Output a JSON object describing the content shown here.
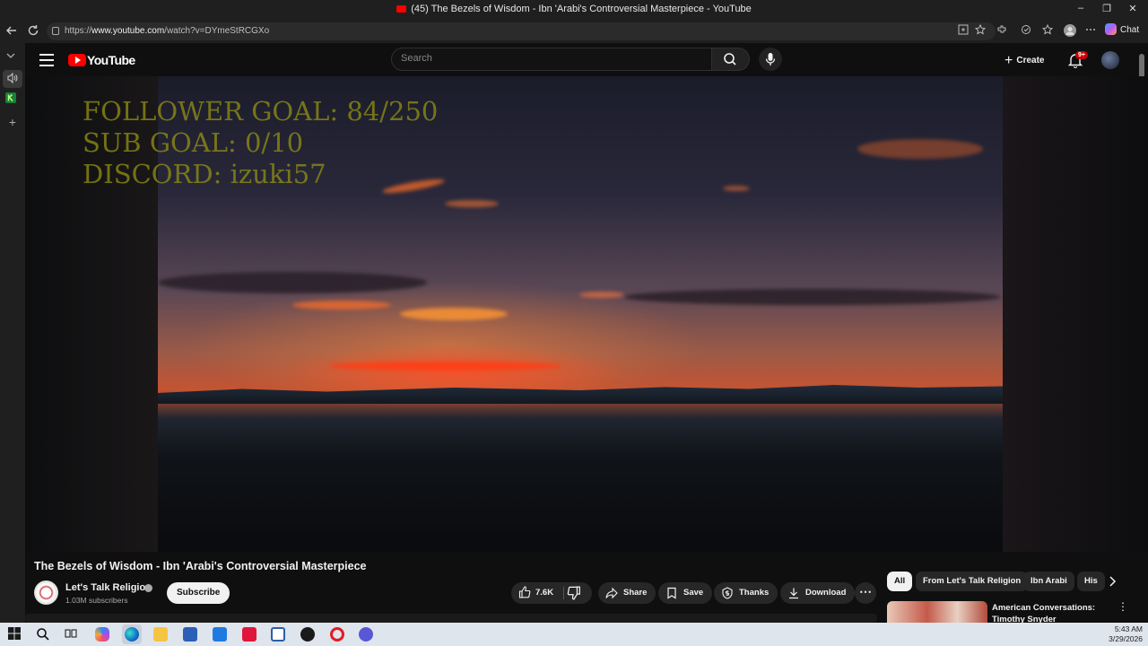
{
  "window": {
    "title": "(45) The Bezels of Wisdom - Ibn 'Arabi's Controversial Masterpiece - YouTube"
  },
  "address_bar": {
    "url_prefix": "https://",
    "url_host": "www.youtube.com",
    "url_path": "/watch?v=DYmeStRCGXo"
  },
  "browser": {
    "chat_label": "Chat"
  },
  "header": {
    "logo_text": "YouTube",
    "search_placeholder": "Search",
    "create_label": "Create",
    "notification_count": "9+"
  },
  "video": {
    "overlay_lines": [
      "FOLLOWER GOAL:  84/250",
      "SUB GOAL: 0/10",
      "DISCORD: izuki57"
    ],
    "title": "The Bezels of Wisdom - Ibn 'Arabi's Controversial Masterpiece",
    "channel_name": "Let's Talk Religion",
    "subscriber_count": "1.03M subscribers",
    "subscribe_label": "Subscribe",
    "like_count": "7.6K",
    "actions": {
      "share": "Share",
      "save": "Save",
      "thanks": "Thanks",
      "download": "Download"
    }
  },
  "chips": [
    "All",
    "From Let's Talk Religion",
    "Ibn Arabi",
    "His"
  ],
  "recommendation": {
    "title": "American Conversations: Timothy Snyder"
  },
  "taskbar": {
    "time": "5:43 AM",
    "date": "3/29/2026"
  },
  "colors": {
    "yt_red": "#ff0000",
    "overlay_text": "#8c8a14",
    "bg": "#0f0f0f"
  }
}
